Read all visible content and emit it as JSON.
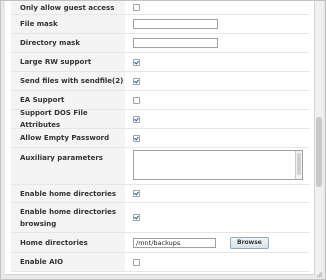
{
  "form": {
    "rows": [
      {
        "label": "Only allow guest access",
        "type": "checkbox",
        "checked": false
      },
      {
        "label": "File mask",
        "type": "text",
        "value": ""
      },
      {
        "label": "Directory mask",
        "type": "text",
        "value": ""
      },
      {
        "label": "Large RW support",
        "type": "checkbox",
        "checked": true
      },
      {
        "label": "Send files with sendfile(2)",
        "type": "checkbox",
        "checked": true
      },
      {
        "label": "EA Support",
        "type": "checkbox",
        "checked": false
      },
      {
        "label": "Support DOS File Attributes",
        "type": "checkbox",
        "checked": true
      },
      {
        "label": "Allow Empty Password",
        "type": "checkbox",
        "checked": true
      },
      {
        "label": "Auxiliary parameters",
        "type": "textarea",
        "value": ""
      },
      {
        "label": "Enable home directories",
        "type": "checkbox",
        "checked": true
      },
      {
        "label": "Enable home directories browsing",
        "type": "checkbox",
        "checked": true
      },
      {
        "label": "Home directories",
        "type": "text-browse",
        "value": "/mnt/backups",
        "button": "Browse"
      },
      {
        "label": "Enable AIO",
        "type": "checkbox",
        "checked": false
      }
    ]
  },
  "icons": {
    "resize_grip": "resize-grip-icon"
  }
}
